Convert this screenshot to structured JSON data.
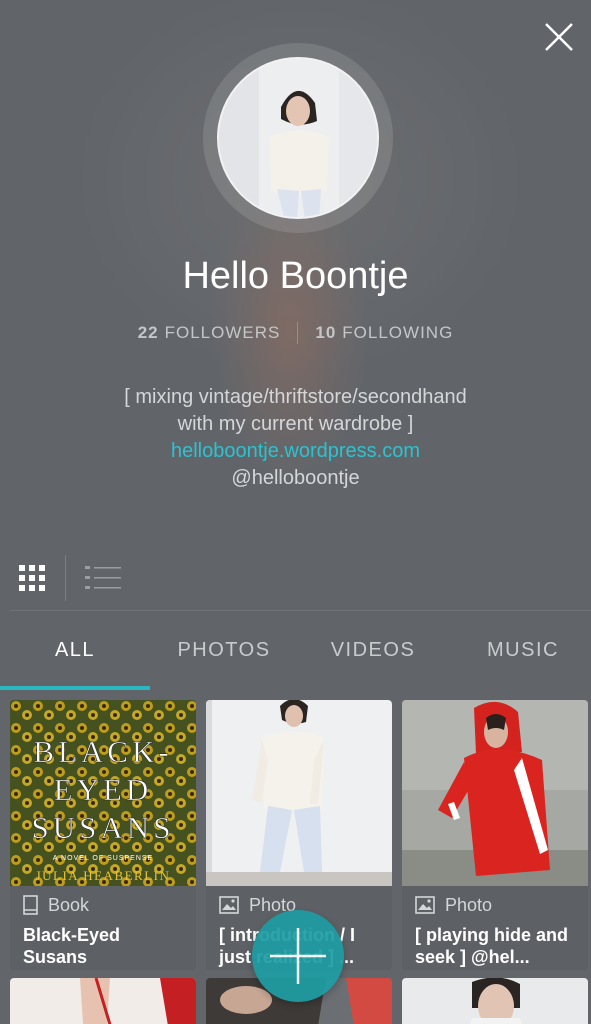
{
  "profile": {
    "name": "Hello Boontje",
    "followers_count": "22",
    "followers_label": "FOLLOWERS",
    "following_count": "10",
    "following_label": "FOLLOWING",
    "bio_line1": "[ mixing vintage/thriftstore/secondhand",
    "bio_line2": "with my current wardrobe ]",
    "website": "helloboontje.wordpress.com",
    "handle": "@helloboontje"
  },
  "view_toggle": {
    "grid_icon": "grid-icon",
    "list_icon": "list-icon"
  },
  "tabs": [
    {
      "label": "ALL",
      "active": true
    },
    {
      "label": "PHOTOS",
      "active": false
    },
    {
      "label": "VIDEOS",
      "active": false
    },
    {
      "label": "MUSIC",
      "active": false
    }
  ],
  "cards": [
    {
      "type": "Book",
      "icon": "book-icon",
      "title": "Black-Eyed Susans",
      "cover_title_1": "BLACK-",
      "cover_title_2": "EYED",
      "cover_title_3": "SUSANS",
      "cover_subtitle": "A NOVEL OF SUSPENSE",
      "cover_author": "JULIA HEABERLIN"
    },
    {
      "type": "Photo",
      "icon": "image-icon",
      "title": "[ introduction / I just realized ] ..."
    },
    {
      "type": "Photo",
      "icon": "image-icon",
      "title": "[ playing hide and seek ] @hel..."
    }
  ],
  "colors": {
    "accent": "#2bb7bf",
    "link": "#2bc3d0",
    "background": "#62666a",
    "fab": "#1e9da3"
  }
}
